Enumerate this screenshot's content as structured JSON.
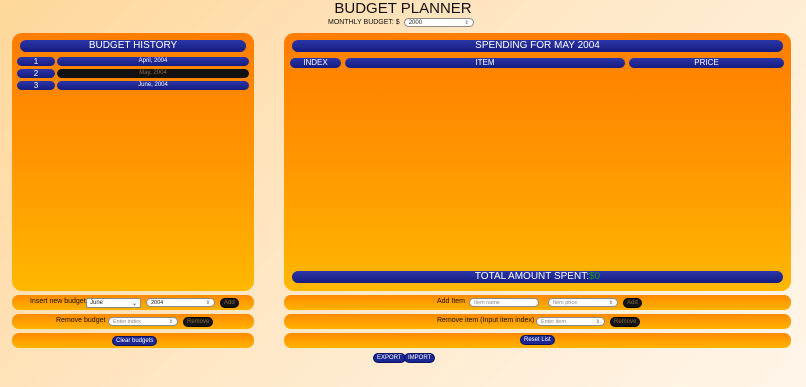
{
  "header": {
    "title": "BUDGET PLANNER",
    "monthly_budget_label": "MONTHLY BUDGET: $",
    "monthly_budget_value": "2000",
    "spinner_glyph": "⇕"
  },
  "history": {
    "title": "BUDGET HISTORY",
    "rows": [
      {
        "index": "1",
        "label": "April, 2004"
      },
      {
        "index": "2",
        "label": "May, 2004"
      },
      {
        "index": "3",
        "label": "June, 2004"
      }
    ]
  },
  "spending": {
    "title": "SPENDING FOR MAY 2004",
    "columns": {
      "index": "INDEX",
      "item": "ITEM",
      "price": "PRICE"
    },
    "total_label": "TOTAL AMOUNT SPENT:",
    "total_value": "$0"
  },
  "controls": {
    "insert_budget_label": "Insert new budget",
    "month_selected": "June",
    "year_value": "2004",
    "add_label": "Add",
    "remove_budget_label": "Remove budget",
    "remove_budget_placeholder": "Enter index",
    "remove_label": "Remove",
    "clear_budgets_label": "Clear budgets",
    "add_item_label": "Add Item",
    "item_name_placeholder": "Item name",
    "item_price_placeholder": "Item price",
    "remove_item_label": "Remove item (Input item index)",
    "remove_item_placeholder": "Enter item",
    "reset_list_label": "Reset List",
    "export_label": "EXPORT",
    "import_label": "IMPORT",
    "chevron_glyph": "⌄"
  }
}
